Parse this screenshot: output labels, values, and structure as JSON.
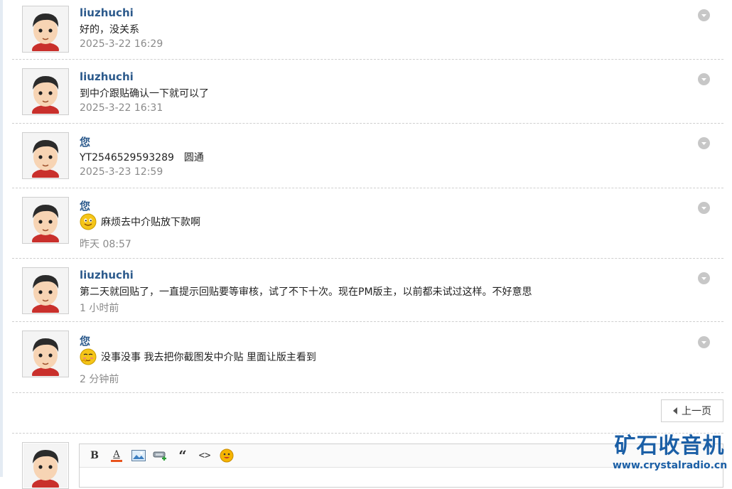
{
  "messages": [
    {
      "author": "liuzhuchi",
      "text": "好的，没关系",
      "time": "2025-3-22 16:29",
      "emoji": ""
    },
    {
      "author": "liuzhuchi",
      "text": "到中介跟贴确认一下就可以了",
      "time": "2025-3-22 16:31",
      "emoji": ""
    },
    {
      "author": "您",
      "text": "YT2546529593289　圆通",
      "time": "2025-3-23 12:59",
      "emoji": ""
    },
    {
      "author": "您",
      "text": "麻烦去中介贴放下款啊",
      "time": "昨天 08:57",
      "emoji": "smile"
    },
    {
      "author": "liuzhuchi",
      "text": "第二天就回贴了，一直提示回贴要等审核，试了不下十次。现在PM版主，以前都未试过这样。不好意思",
      "time": "1 小时前",
      "emoji": ""
    },
    {
      "author": "您",
      "text": "没事没事 我去把你截图发中介贴 里面让版主看到",
      "time": "2 分钟前",
      "emoji": "shy"
    }
  ],
  "pager": {
    "prev_label": "上一页"
  },
  "editor": {
    "toolbar": [
      "bold-icon",
      "font-color-icon",
      "image-icon",
      "link-icon",
      "quote-icon",
      "code-icon",
      "emoji-icon"
    ],
    "bold_label": "B",
    "color_label": "A",
    "quote_label": "“",
    "code_label": "<>"
  },
  "watermark": {
    "title": "矿石收音机",
    "url": "www.crystalradio.cn"
  },
  "colors": {
    "author": "#2c5a8c",
    "time": "#8a8a8a",
    "watermark": "#1b5fa6"
  }
}
